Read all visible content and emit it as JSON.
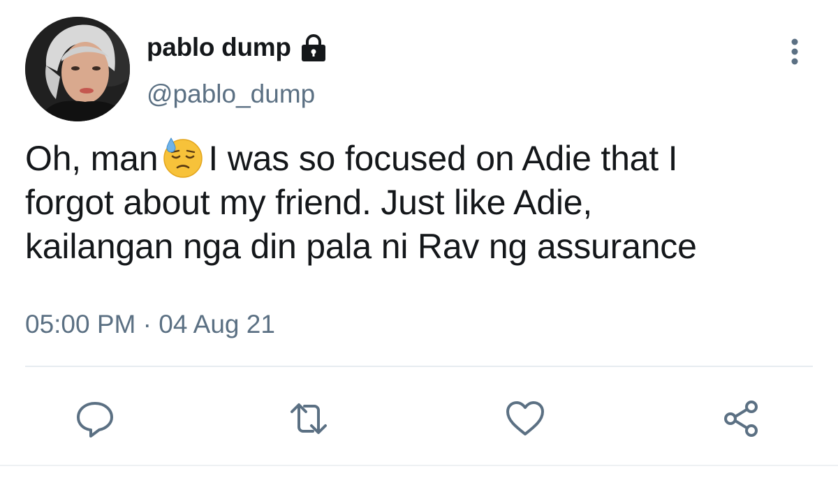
{
  "user": {
    "display_name": "pablo dump",
    "handle": "@pablo_dump",
    "protected_icon": "lock-icon"
  },
  "tweet": {
    "text_line1_before_emoji": "Oh, man",
    "emoji": "downcast-face-with-sweat-emoji",
    "text_line1_after_emoji": "I was so focused on Adie that I",
    "text_line2": "forgot about my friend. Just like Adie,",
    "text_line3": "kailangan nga din pala ni Rav ng assurance",
    "time": "05:00 PM",
    "separator": "·",
    "date": "04 Aug 21"
  },
  "actions": [
    {
      "name": "reply",
      "icon": "reply-icon"
    },
    {
      "name": "retweet",
      "icon": "retweet-icon"
    },
    {
      "name": "like",
      "icon": "heart-icon"
    },
    {
      "name": "share",
      "icon": "share-icon"
    }
  ],
  "colors": {
    "text_primary": "#14171a",
    "text_secondary": "#5b7083",
    "icon": "#5b7083",
    "divider": "#e6ecf0"
  }
}
